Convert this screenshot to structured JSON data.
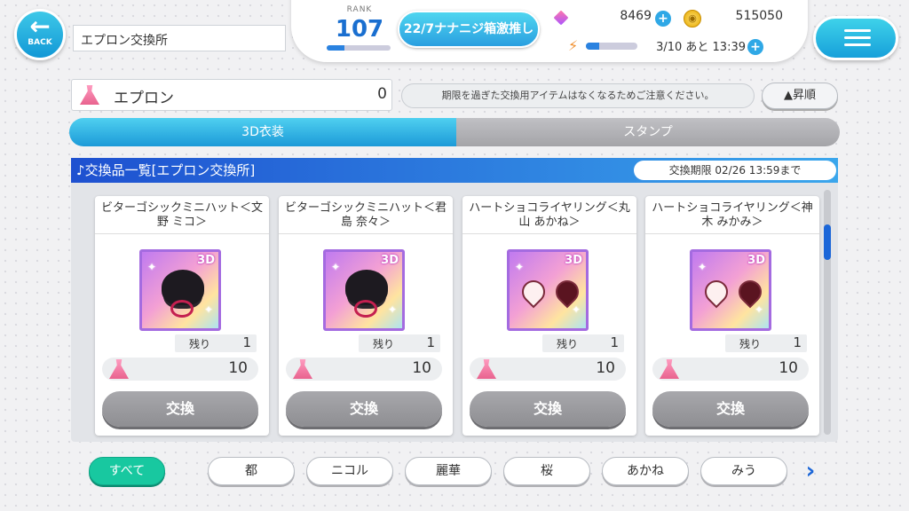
{
  "header": {
    "back_label": "BACK",
    "page_title": "エプロン交換所",
    "rank_label": "RANK",
    "rank_value": "107",
    "rank_progress": 0.28,
    "banner_text": "22/7ナナニジ箱激推し",
    "gems": "8469",
    "coins": "515050",
    "stamina": "3/10 あと 13:39",
    "stamina_progress": 0.25
  },
  "item_bar": {
    "item_name": "エプロン",
    "item_count": "0",
    "notice": "期限を過ぎた交換用アイテムはなくなるためご注意ください。",
    "sort_label": "▲昇順"
  },
  "tabs": [
    {
      "label": "3D衣装",
      "active": true
    },
    {
      "label": "スタンプ",
      "active": false
    }
  ],
  "list": {
    "heading": "♪交換品一覧[エプロン交換所]",
    "deadline": "交換期限 02/26 13:59まで",
    "remaining_label": "残り",
    "exchange_label": "交換",
    "items": [
      {
        "name": "ビターゴシックミニハット＜文野 ミコ＞",
        "type": "hat",
        "remaining": "1",
        "cost": "10"
      },
      {
        "name": "ビターゴシックミニハット＜君島 奈々＞",
        "type": "hat",
        "remaining": "1",
        "cost": "10"
      },
      {
        "name": "ハートショコライヤリング＜丸山 あかね＞",
        "type": "earring",
        "remaining": "1",
        "cost": "10"
      },
      {
        "name": "ハートショコライヤリング＜神木 みかみ＞",
        "type": "earring",
        "remaining": "1",
        "cost": "10"
      }
    ]
  },
  "filters": [
    {
      "label": "すべて",
      "active": true
    },
    {
      "label": "都",
      "active": false
    },
    {
      "label": "ニコル",
      "active": false
    },
    {
      "label": "麗華",
      "active": false
    },
    {
      "label": "桜",
      "active": false
    },
    {
      "label": "あかね",
      "active": false
    },
    {
      "label": "みう",
      "active": false
    }
  ],
  "icons": [
    "back-arrow-icon",
    "gem-icon",
    "coin-icon",
    "stamina-icon",
    "menu-icon",
    "apron-icon",
    "chevron-right-icon"
  ]
}
